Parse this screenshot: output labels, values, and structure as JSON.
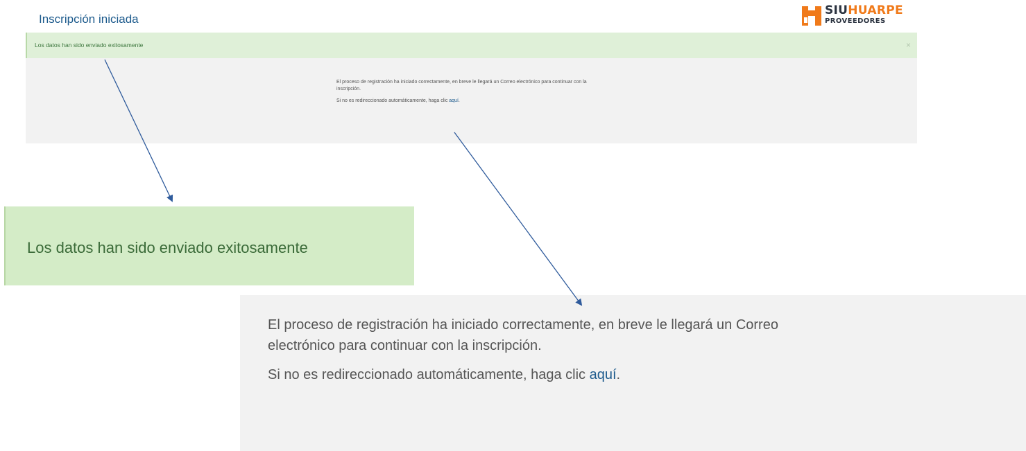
{
  "page": {
    "title": "Inscripción iniciada"
  },
  "logo": {
    "siu": "SIU",
    "huarpe": "HUARPE",
    "subtitle": "PROVEEDORES",
    "colors": {
      "dark": "#2b3340",
      "orange": "#f07a1a"
    }
  },
  "alert": {
    "message": "Los datos han sido enviado exitosamente",
    "close_symbol": "×",
    "color": "#3c763d",
    "background": "#dff0d8"
  },
  "panel": {
    "paragraph1": "El proceso de registración ha iniciado correctamente, en breve le llegará un Correo electrónico para continuar con la inscripción.",
    "paragraph2_prefix": "Si no es redireccionado automáticamente, haga clic ",
    "link_text": "aquí",
    "paragraph2_suffix": "."
  },
  "annotations": {
    "arrow_color": "#2f5b9c"
  }
}
